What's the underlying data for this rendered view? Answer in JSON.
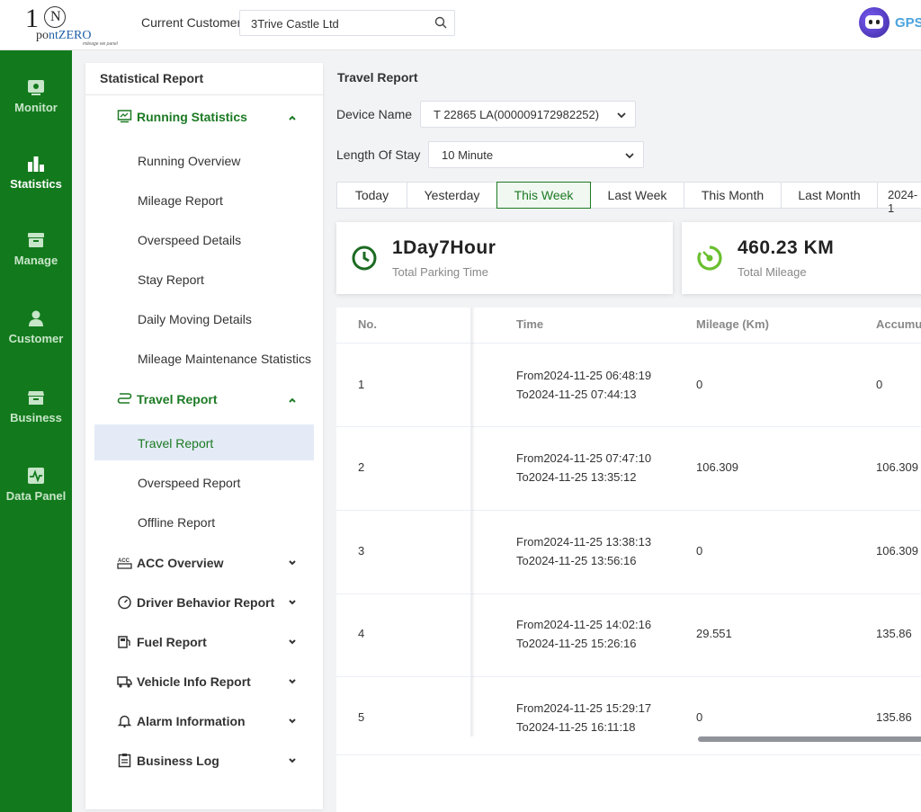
{
  "header": {
    "logo_big": "1",
    "logo_n": "N",
    "logo_point": "po",
    "logo_nt": "nt",
    "logo_zero": "ZERO",
    "logo_tagline": "mileage we panel",
    "current_customer_label": "Current Customer",
    "current_customer_value": "3Trive Castle Ltd",
    "brand_text": "GPS"
  },
  "rail": {
    "items": [
      {
        "label": "Monitor",
        "icon": "monitor-icon"
      },
      {
        "label": "Statistics",
        "icon": "statistics-icon",
        "active": true
      },
      {
        "label": "Manage",
        "icon": "manage-icon"
      },
      {
        "label": "Customer",
        "icon": "customer-icon"
      },
      {
        "label": "Business",
        "icon": "business-icon"
      },
      {
        "label": "Data Panel",
        "icon": "data-panel-icon"
      }
    ]
  },
  "menu": {
    "title": "Statistical Report",
    "running_statistics": "Running Statistics",
    "running_items": [
      "Running Overview",
      "Mileage Report",
      "Overspeed Details",
      "Stay Report",
      "Daily Moving Details",
      "Mileage Maintenance Statistics"
    ],
    "travel_report_group": "Travel Report",
    "travel_items": [
      "Travel Report",
      "Overspeed Report",
      "Offline Report"
    ],
    "acc_overview": "ACC Overview",
    "driver_behavior": "Driver Behavior Report",
    "fuel_report": "Fuel Report",
    "vehicle_info": "Vehicle Info Report",
    "alarm_information": "Alarm Information",
    "business_log": "Business Log"
  },
  "main": {
    "title": "Travel Report",
    "device_name_label": "Device Name",
    "device_name_value": "T 22865 LA(000009172982252)",
    "length_of_stay_label": "Length Of Stay",
    "length_of_stay_value": "10 Minute",
    "tabs": [
      "Today",
      "Yesterday",
      "This Week",
      "Last Week",
      "This Month",
      "Last Month"
    ],
    "active_tab": "This Week",
    "date_value": "2024-1",
    "cards": [
      {
        "value": "1Day7Hour",
        "caption": "Total Parking Time",
        "color": "#1c6b22"
      },
      {
        "value": "460.23 KM",
        "caption": "Total Mileage",
        "color": "#6abf2e"
      }
    ]
  },
  "table": {
    "headers": {
      "no": "No.",
      "time": "Time",
      "mileage": "Mileage (Km)",
      "accum": "Accumu"
    },
    "rows": [
      {
        "no": "1",
        "from": "From2024-11-25 06:48:19",
        "to": "To2024-11-25 07:44:13",
        "mileage": "0",
        "accum": "0"
      },
      {
        "no": "2",
        "from": "From2024-11-25 07:47:10",
        "to": "To2024-11-25 13:35:12",
        "mileage": "106.309",
        "accum": "106.309"
      },
      {
        "no": "3",
        "from": "From2024-11-25 13:38:13",
        "to": "To2024-11-25 13:56:16",
        "mileage": "0",
        "accum": "106.309"
      },
      {
        "no": "4",
        "from": "From2024-11-25 14:02:16",
        "to": "To2024-11-25 15:26:16",
        "mileage": "29.551",
        "accum": "135.86"
      },
      {
        "no": "5",
        "from": "From2024-11-25 15:29:17",
        "to": "To2024-11-25 16:11:18",
        "mileage": "0",
        "accum": "135.86"
      }
    ]
  }
}
